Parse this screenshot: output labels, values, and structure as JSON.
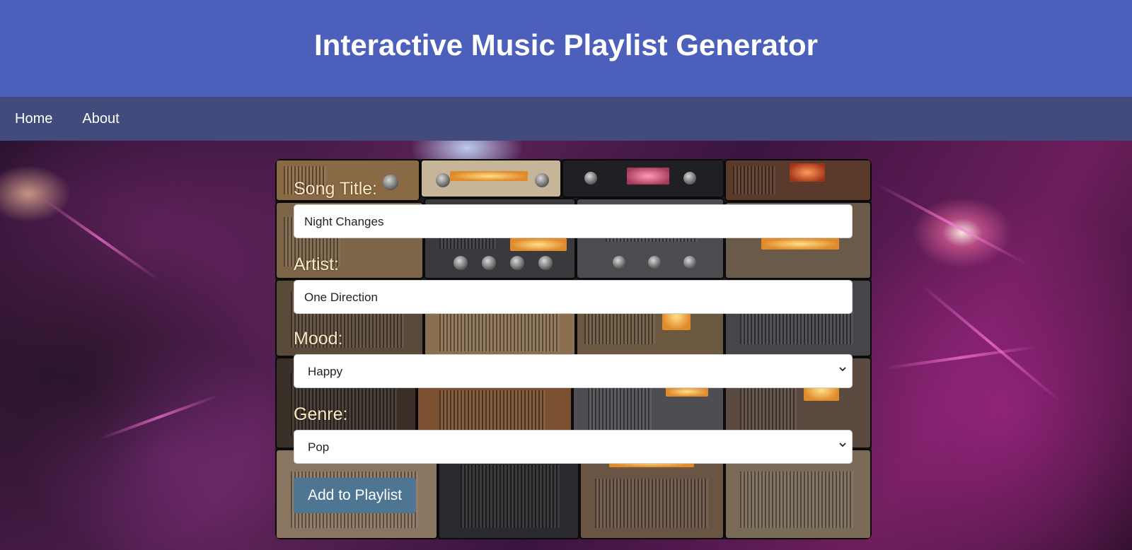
{
  "header": {
    "title": "Interactive Music Playlist Generator"
  },
  "nav": {
    "items": [
      "Home",
      "About"
    ]
  },
  "form": {
    "song_title": {
      "label": "Song Title:",
      "value": "Night Changes"
    },
    "artist": {
      "label": "Artist:",
      "value": "One Direction"
    },
    "mood": {
      "label": "Mood:",
      "value": "Happy"
    },
    "genre": {
      "label": "Genre:",
      "value": "Pop"
    },
    "submit_label": "Add to Playlist"
  },
  "colors": {
    "header_bg": "#4b5fbb",
    "nav_bg": "#424b7c",
    "label_text": "#fde8c4",
    "button_bg": "#4e7592"
  }
}
